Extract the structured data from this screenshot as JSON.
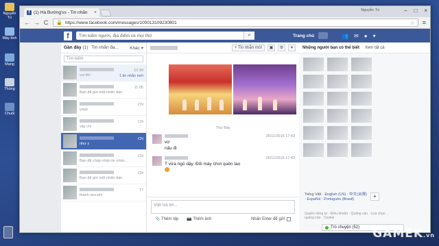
{
  "desktop": {
    "icons": [
      {
        "label": "Nguyễn Tú",
        "icon": "folder-icon"
      },
      {
        "label": "Máy tính",
        "icon": "computer-icon"
      },
      {
        "label": "Mạng",
        "icon": "network-icon"
      },
      {
        "label": "Thùng",
        "icon": "recycle-icon"
      },
      {
        "label": "Chuối",
        "icon": "app-icon"
      }
    ]
  },
  "browser": {
    "tab_title": "(1) Hà Bướng'ss - Tin nhắn",
    "tab_close": "×",
    "user_label": "Nguyễn Tú",
    "window_controls": [
      "–",
      "□",
      "×"
    ],
    "url": "https://www.facebook.com/messages/100013109230801",
    "nav": {
      "back": "←",
      "forward": "→",
      "reload": "C"
    },
    "star": "☆",
    "menu": "≡"
  },
  "facebook": {
    "logo": "f",
    "search_placeholder": "Tìm kiếm người, địa điểm và mọi thứ",
    "search_icon": "⌕",
    "home": "Trang chủ"
  },
  "inbox": {
    "tabs": {
      "recent": "Gần đây",
      "recent_count": "(1)",
      "requests": "Tin nhắn đa...",
      "more": "Khác ▾"
    },
    "search_placeholder": "Tìm kiếm",
    "conversations": [
      {
        "preview": "vui khi",
        "time": "12:30",
        "extra": "1 tin nhắn mới",
        "style": "first"
      },
      {
        "preview": "Bạn đã gửi một nhãn dán.",
        "time": "11:05",
        "style": ""
      },
      {
        "preview": "yepp",
        "time": "CN",
        "style": ""
      },
      {
        "preview": "vậy chi",
        "time": "CN",
        "style": ""
      },
      {
        "preview": "như z",
        "time": "CN",
        "style": "active"
      },
      {
        "preview": "Bạn đã chấp nhận tin nhắn...",
        "time": "CN",
        "style": ""
      },
      {
        "preview": "Bạn đã gửi một nhãn dán.",
        "time": "CN",
        "style": ""
      },
      {
        "preview": "thanh seo-phì",
        "time": "T7",
        "style": ""
      }
    ]
  },
  "thread": {
    "new_message_button": "+ Tin nhắn mới",
    "settings_icon": "⚙",
    "divider": "Thứ Bảy",
    "messages": [
      {
        "lines": [
          "vợ",
          "nấu đi"
        ],
        "time": "26/11/2016 17:43"
      },
      {
        "lines": [
          "T vừa ngủ dậy. Đối mày chơi quên tao"
        ],
        "time": "26/11/2016 17:43"
      }
    ],
    "composer_placeholder": "Viết trả lời...",
    "add_files": "Thêm tệp",
    "add_photos": "Thêm ảnh",
    "press_enter": "Nhấn Enter để gửi"
  },
  "sidebar": {
    "people_you_may_know": "Những người bạn có thể biết",
    "see_all": "Xem tất cả",
    "languages": {
      "current": "Tiếng Việt",
      "others": "English (US) · 中文(台灣) · Español · Português (Brasil)"
    },
    "add_language": "+",
    "footer": "Quyền riêng tư · Điều khoản · Quảng cáo · Lựa chọn quảng cáo · Cookie",
    "chat": "Trò chuyện (52)"
  },
  "watermark": {
    "main": "GAMEK",
    "suffix": ".vn"
  }
}
